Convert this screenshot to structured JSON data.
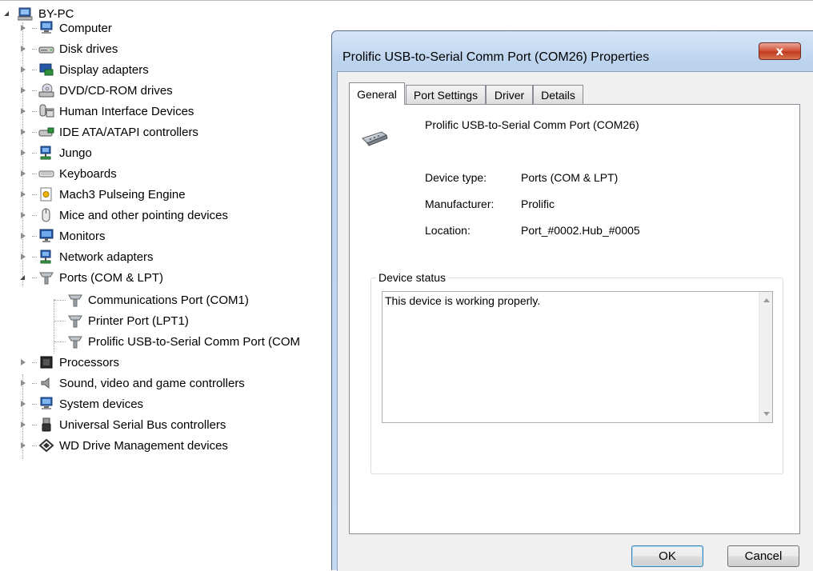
{
  "tree": {
    "root": "BY-PC",
    "categories": [
      {
        "label": "Computer",
        "icon": "computer-icon"
      },
      {
        "label": "Disk drives",
        "icon": "disk-drive-icon"
      },
      {
        "label": "Display adapters",
        "icon": "display-adapter-icon"
      },
      {
        "label": "DVD/CD-ROM drives",
        "icon": "dvd-drive-icon"
      },
      {
        "label": "Human Interface Devices",
        "icon": "hid-icon"
      },
      {
        "label": "IDE ATA/ATAPI controllers",
        "icon": "ide-controller-icon"
      },
      {
        "label": "Jungo",
        "icon": "network-icon"
      },
      {
        "label": "Keyboards",
        "icon": "keyboard-icon"
      },
      {
        "label": "Mach3 Pulseing Engine",
        "icon": "driver-icon"
      },
      {
        "label": "Mice and other pointing devices",
        "icon": "mouse-icon"
      },
      {
        "label": "Monitors",
        "icon": "monitor-icon"
      },
      {
        "label": "Network adapters",
        "icon": "network-icon"
      },
      {
        "label": "Ports (COM & LPT)",
        "icon": "port-icon"
      },
      {
        "label": "Processors",
        "icon": "processor-icon"
      },
      {
        "label": "Sound, video and game controllers",
        "icon": "speaker-icon"
      },
      {
        "label": "System devices",
        "icon": "computer-icon"
      },
      {
        "label": "Universal Serial Bus controllers",
        "icon": "usb-icon"
      },
      {
        "label": "WD Drive Management devices",
        "icon": "wd-icon"
      }
    ],
    "ports_children": [
      "Communications Port (COM1)",
      "Printer Port (LPT1)",
      "Prolific USB-to-Serial Comm Port (COM"
    ]
  },
  "dialog": {
    "title": "Prolific USB-to-Serial Comm Port (COM26) Properties",
    "close_glyph": "x",
    "tabs": [
      "General",
      "Port Settings",
      "Driver",
      "Details"
    ],
    "device_name": "Prolific USB-to-Serial Comm Port (COM26)",
    "device_type_label": "Device type:",
    "device_type_value": "Ports (COM & LPT)",
    "manufacturer_label": "Manufacturer:",
    "manufacturer_value": "Prolific",
    "location_label": "Location:",
    "location_value": "Port_#0002.Hub_#0005",
    "status_legend": "Device status",
    "status_text": "This device is working properly.",
    "ok_label": "OK",
    "cancel_label": "Cancel"
  },
  "colors": {
    "title_bar": "#c4d8f1",
    "close_button": "#c84a32",
    "tab_border": "#898c95"
  }
}
